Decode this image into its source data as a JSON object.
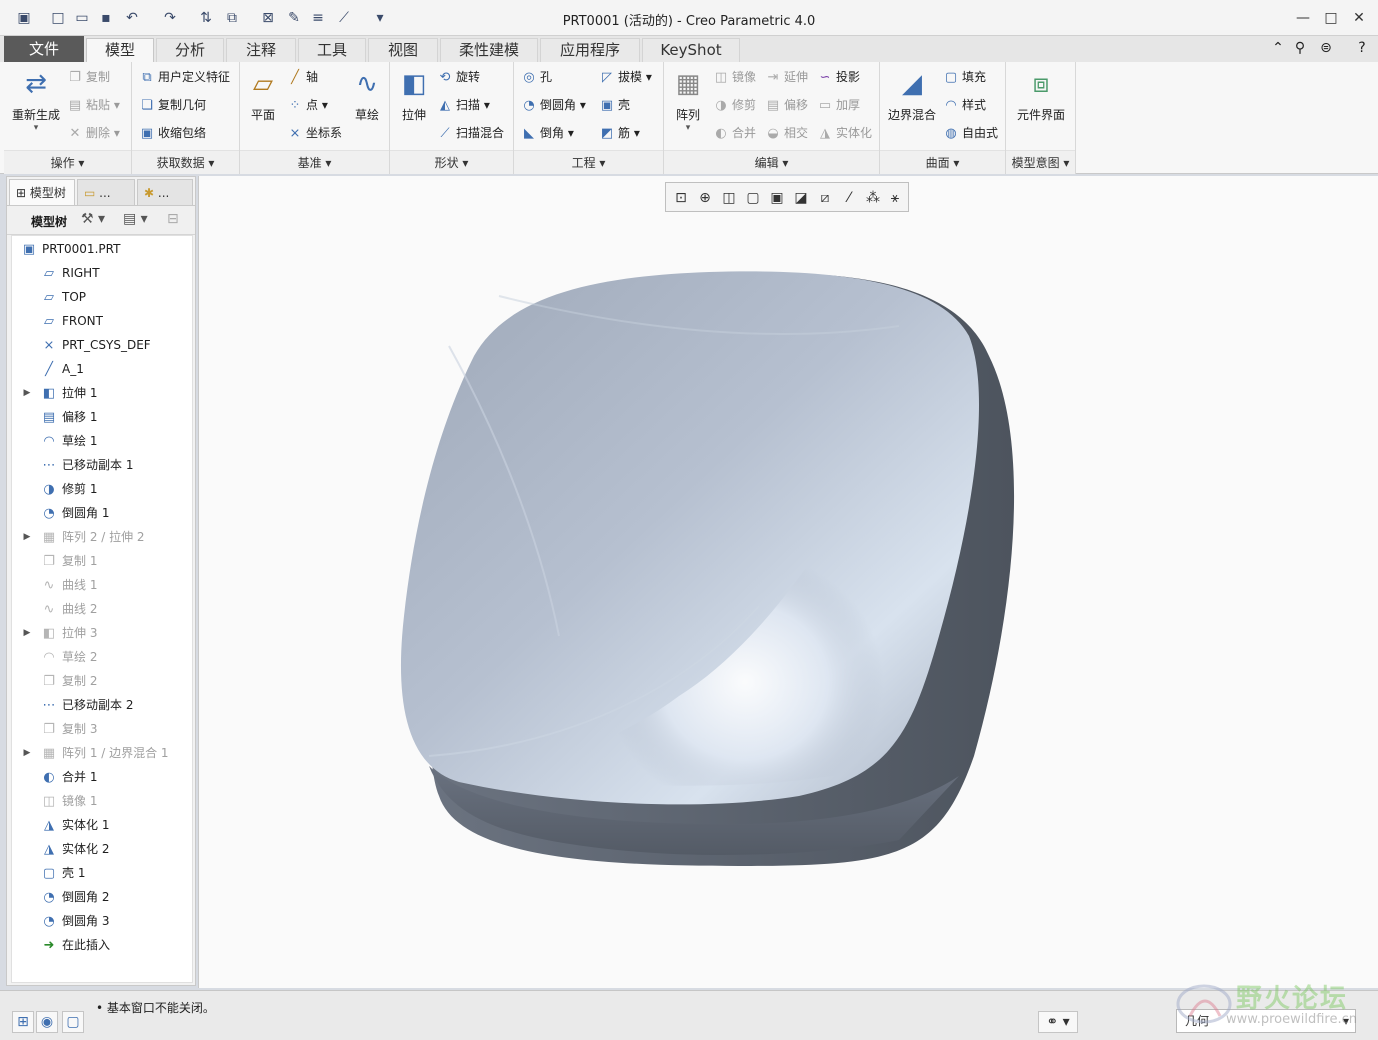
{
  "window": {
    "title": "PRT0001 (活动的) - Creo Parametric 4.0",
    "controls": [
      "minimize-icon",
      "maximize-icon",
      "close-icon"
    ]
  },
  "quick_access": [
    "new-icon",
    "open-icon",
    "save-icon",
    "undo-icon",
    "redo-icon",
    "regenerate-icon",
    "windows-icon",
    "close-window-icon",
    "more-icon"
  ],
  "tabs": [
    {
      "label": "文件",
      "state": "file"
    },
    {
      "label": "模型",
      "state": "active"
    },
    {
      "label": "分析",
      "state": "normal"
    },
    {
      "label": "注释",
      "state": "normal"
    },
    {
      "label": "工具",
      "state": "normal"
    },
    {
      "label": "视图",
      "state": "normal"
    },
    {
      "label": "柔性建模",
      "state": "normal"
    },
    {
      "label": "应用程序",
      "state": "normal"
    },
    {
      "label": "KeyShot",
      "state": "normal"
    }
  ],
  "ribbon": {
    "groups": {
      "operations": "操作",
      "get_data": "获取数据",
      "datum": "基准",
      "shapes": "形状",
      "engineering": "工程",
      "editing": "编辑",
      "surfaces": "曲面",
      "model_intent": "模型意图"
    },
    "buttons": {
      "regenerate": "重新生成",
      "copy": "复制",
      "paste": "粘贴",
      "delete": "删除",
      "udf": "用户定义特征",
      "copy_geom": "复制几何",
      "shrinkwrap": "收缩包络",
      "plane": "平面",
      "axis": "轴",
      "point": "点",
      "csys": "坐标系",
      "sketch": "草绘",
      "extrude": "拉伸",
      "revolve": "旋转",
      "sweep": "扫描",
      "swept_blend": "扫描混合",
      "hole": "孔",
      "round": "倒圆角",
      "chamfer": "倒角",
      "draft": "拔模",
      "shell": "壳",
      "rib": "筋",
      "pattern": "阵列",
      "mirror": "镜像",
      "extend": "延伸",
      "project": "投影",
      "trim": "修剪",
      "offset": "偏移",
      "thicken": "加厚",
      "merge": "合并",
      "intersect": "相交",
      "solidify": "实体化",
      "boundary_blend": "边界混合",
      "fill": "填充",
      "style": "样式",
      "freestyle": "自由式",
      "component_interface": "元件界面"
    }
  },
  "left_panel": {
    "tabs": [
      {
        "label": "模型树"
      },
      {
        "label": "..."
      },
      {
        "label": "..."
      }
    ],
    "toolbar_label": "模型树",
    "tree": [
      {
        "label": "PRT0001.PRT",
        "icon": "part-icon",
        "dim": false,
        "expandable": false,
        "level": 0
      },
      {
        "label": "RIGHT",
        "icon": "datum-plane-icon",
        "dim": false,
        "expandable": false,
        "level": 1
      },
      {
        "label": "TOP",
        "icon": "datum-plane-icon",
        "dim": false,
        "expandable": false,
        "level": 1
      },
      {
        "label": "FRONT",
        "icon": "datum-plane-icon",
        "dim": false,
        "expandable": false,
        "level": 1
      },
      {
        "label": "PRT_CSYS_DEF",
        "icon": "csys-icon",
        "dim": false,
        "expandable": false,
        "level": 1
      },
      {
        "label": "A_1",
        "icon": "axis-icon",
        "dim": false,
        "expandable": false,
        "level": 1
      },
      {
        "label": "拉伸 1",
        "icon": "extrude-icon",
        "dim": false,
        "expandable": true,
        "level": 1
      },
      {
        "label": "偏移 1",
        "icon": "offset-icon",
        "dim": false,
        "expandable": false,
        "level": 1
      },
      {
        "label": "草绘 1",
        "icon": "sketch-icon",
        "dim": false,
        "expandable": false,
        "level": 1
      },
      {
        "label": "已移动副本 1",
        "icon": "moved-copy-icon",
        "dim": false,
        "expandable": false,
        "level": 1
      },
      {
        "label": "修剪 1",
        "icon": "trim-icon",
        "dim": false,
        "expandable": false,
        "level": 1
      },
      {
        "label": "倒圆角 1",
        "icon": "round-icon",
        "dim": false,
        "expandable": false,
        "level": 1
      },
      {
        "label": "阵列 2 / 拉伸 2",
        "icon": "pattern-icon",
        "dim": true,
        "expandable": true,
        "level": 1
      },
      {
        "label": "复制 1",
        "icon": "copy-icon",
        "dim": true,
        "expandable": false,
        "level": 1
      },
      {
        "label": "曲线 1",
        "icon": "curve-icon",
        "dim": true,
        "expandable": false,
        "level": 1
      },
      {
        "label": "曲线 2",
        "icon": "curve-icon",
        "dim": true,
        "expandable": false,
        "level": 1
      },
      {
        "label": "拉伸 3",
        "icon": "extrude-icon",
        "dim": true,
        "expandable": true,
        "level": 1
      },
      {
        "label": "草绘 2",
        "icon": "sketch-icon",
        "dim": true,
        "expandable": false,
        "level": 1
      },
      {
        "label": "复制 2",
        "icon": "copy-icon",
        "dim": true,
        "expandable": false,
        "level": 1
      },
      {
        "label": "已移动副本 2",
        "icon": "moved-copy-icon",
        "dim": false,
        "expandable": false,
        "level": 1
      },
      {
        "label": "复制 3",
        "icon": "copy-icon",
        "dim": true,
        "expandable": false,
        "level": 1
      },
      {
        "label": "阵列 1 / 边界混合 1",
        "icon": "pattern-icon",
        "dim": true,
        "expandable": true,
        "level": 1
      },
      {
        "label": "合并 1",
        "icon": "merge-icon",
        "dim": false,
        "expandable": false,
        "level": 1
      },
      {
        "label": "镜像 1",
        "icon": "mirror-icon",
        "dim": true,
        "expandable": false,
        "level": 1
      },
      {
        "label": "实体化 1",
        "icon": "solidify-icon",
        "dim": false,
        "expandable": false,
        "level": 1
      },
      {
        "label": "实体化 2",
        "icon": "solidify-icon",
        "dim": false,
        "expandable": false,
        "level": 1
      },
      {
        "label": "壳 1",
        "icon": "shell-icon",
        "dim": false,
        "expandable": false,
        "level": 1
      },
      {
        "label": "倒圆角 2",
        "icon": "round-icon",
        "dim": false,
        "expandable": false,
        "level": 1
      },
      {
        "label": "倒圆角 3",
        "icon": "round-icon",
        "dim": false,
        "expandable": false,
        "level": 1
      },
      {
        "label": "在此插入",
        "icon": "insert-here-icon",
        "dim": false,
        "expandable": false,
        "level": 1
      }
    ]
  },
  "view_toolbar": [
    "refit-icon",
    "zoom-in-icon",
    "zoom-out-icon",
    "repaint-icon",
    "display-style-icon",
    "saved-views-icon",
    "view-manager-icon",
    "datum-display-icon",
    "annotation-display-icon",
    "spin-center-icon"
  ],
  "status": {
    "message": "基本窗口不能关闭。",
    "filter_value": "几何"
  },
  "watermark": {
    "text": "野火论坛",
    "url": "www.proewildfire.cn"
  },
  "colors": {
    "model_top": "#b8c2d2",
    "model_side": "#5c6470",
    "accent": "#3f6fb0"
  }
}
